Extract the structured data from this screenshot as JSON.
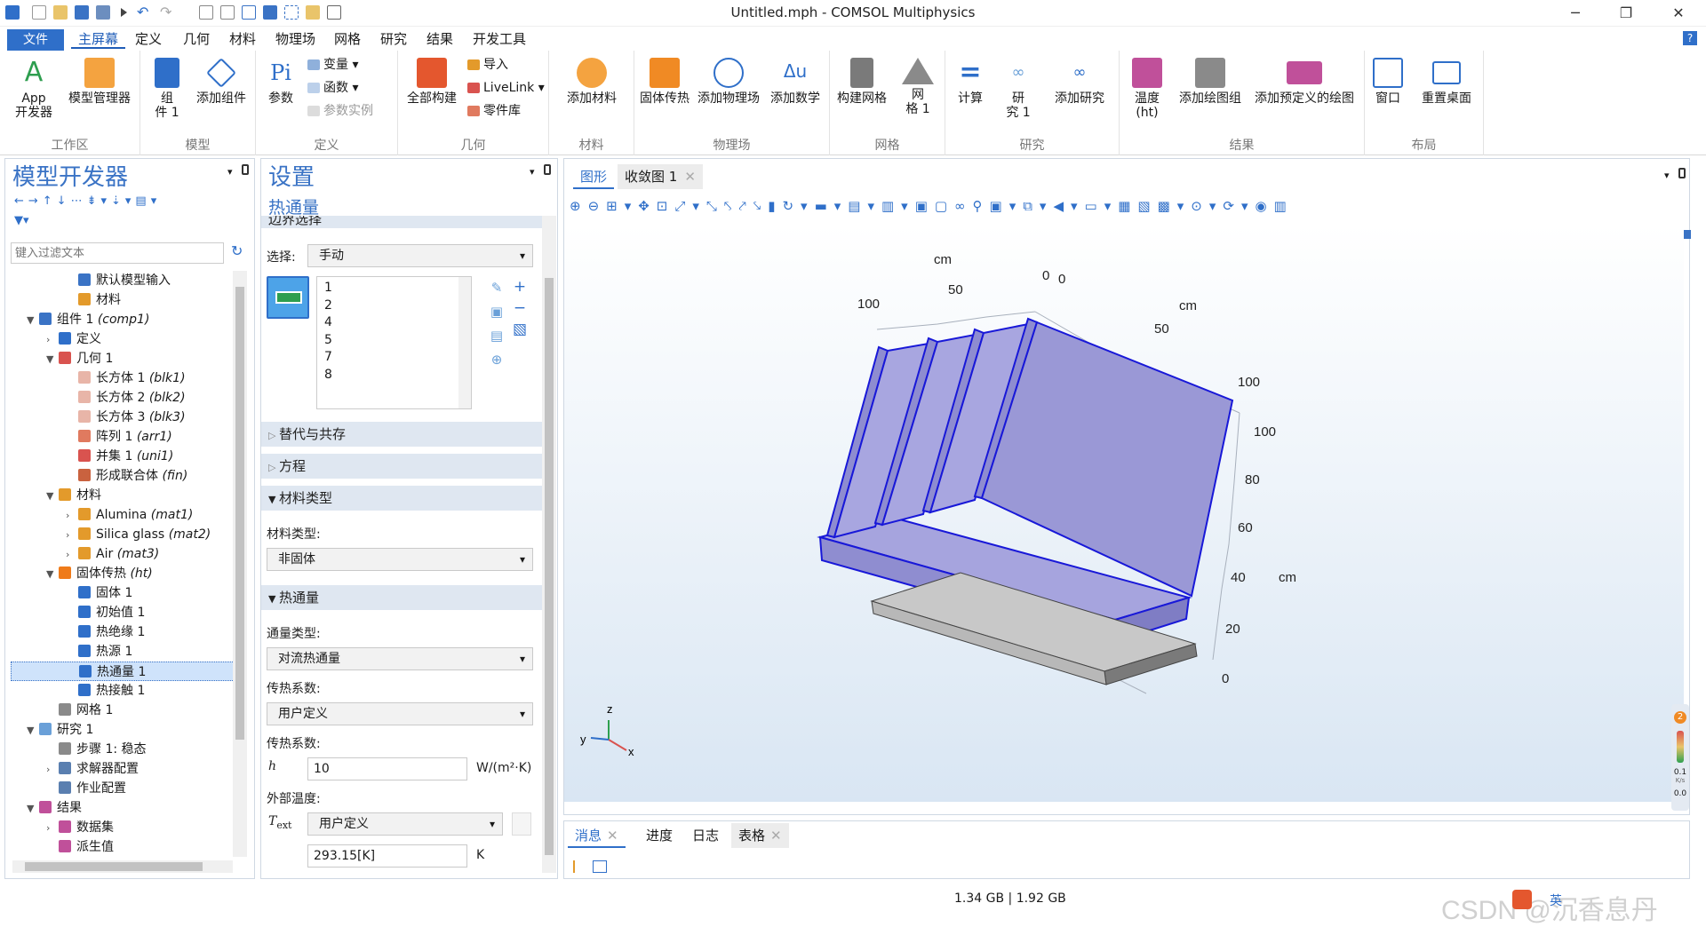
{
  "window": {
    "title": "Untitled.mph - COMSOL Multiphysics",
    "minimize": "─",
    "maximize": "❐",
    "close": "✕"
  },
  "menu": {
    "file": "文件",
    "items": [
      "主屏幕",
      "定义",
      "几何",
      "材料",
      "物理场",
      "网格",
      "研究",
      "结果",
      "开发工具"
    ],
    "help": "?"
  },
  "ribbon": {
    "groups": [
      {
        "label": "工作区",
        "buttons": [
          "App\n开发器",
          "模型管理器"
        ]
      },
      {
        "label": "模型",
        "buttons": [
          "组\n件 1",
          "添加组件"
        ]
      },
      {
        "label": "定义",
        "buttons": [
          "参数"
        ],
        "small": [
          "变量",
          "函数",
          "参数实例"
        ]
      },
      {
        "label": "几何",
        "buttons": [
          "全部构建"
        ],
        "small": [
          "导入",
          "LiveLink",
          "零件库"
        ]
      },
      {
        "label": "材料",
        "buttons": [
          "添加材料"
        ]
      },
      {
        "label": "物理场",
        "buttons": [
          "固体传热",
          "添加物理场",
          "添加数学"
        ]
      },
      {
        "label": "网格",
        "buttons": [
          "构建网格",
          "网\n格 1"
        ]
      },
      {
        "label": "研究",
        "buttons": [
          "计算",
          "研\n究 1",
          "添加研究"
        ]
      },
      {
        "label": "结果",
        "buttons": [
          "温度\n(ht)",
          "添加绘图组",
          "添加预定义的绘图"
        ]
      },
      {
        "label": "布局",
        "buttons": [
          "窗口",
          "重置桌面"
        ]
      }
    ]
  },
  "model_builder": {
    "title": "模型开发器",
    "filter_placeholder": "键入过滤文本",
    "tree": [
      {
        "label": "默认模型输入",
        "tag": "",
        "indent": 3,
        "caret": "",
        "color": "#3a73c5"
      },
      {
        "label": "材料",
        "tag": "",
        "indent": 3,
        "caret": "",
        "color": "#e39a2b"
      },
      {
        "label": "组件 1 ",
        "tag": "(comp1)",
        "indent": 1,
        "caret": "▼",
        "color": "#3a73c5"
      },
      {
        "label": "定义",
        "tag": "",
        "indent": 2,
        "caret": "›",
        "color": "#2f6fc9"
      },
      {
        "label": "几何 1",
        "tag": "",
        "indent": 2,
        "caret": "▼",
        "color": "#d9534f"
      },
      {
        "label": "长方体 1 ",
        "tag": "(blk1)",
        "indent": 3,
        "caret": "",
        "color": "#e8b5a8"
      },
      {
        "label": "长方体 2 ",
        "tag": "(blk2)",
        "indent": 3,
        "caret": "",
        "color": "#e8b5a8"
      },
      {
        "label": "长方体 3 ",
        "tag": "(blk3)",
        "indent": 3,
        "caret": "",
        "color": "#e8b5a8"
      },
      {
        "label": "阵列 1 ",
        "tag": "(arr1)",
        "indent": 3,
        "caret": "",
        "color": "#e07a5f"
      },
      {
        "label": "并集 1 ",
        "tag": "(uni1)",
        "indent": 3,
        "caret": "",
        "color": "#d9534f"
      },
      {
        "label": "形成联合体 ",
        "tag": "(fin)",
        "indent": 3,
        "caret": "",
        "color": "#c9623f"
      },
      {
        "label": "材料",
        "tag": "",
        "indent": 2,
        "caret": "▼",
        "color": "#e39a2b"
      },
      {
        "label": "Alumina ",
        "tag": "(mat1)",
        "indent": 3,
        "caret": "›",
        "color": "#e39a2b"
      },
      {
        "label": "Silica glass ",
        "tag": "(mat2)",
        "indent": 3,
        "caret": "›",
        "color": "#e39a2b"
      },
      {
        "label": "Air ",
        "tag": "(mat3)",
        "indent": 3,
        "caret": "›",
        "color": "#e39a2b"
      },
      {
        "label": "固体传热 ",
        "tag": "(ht)",
        "indent": 2,
        "caret": "▼",
        "color": "#ef7b1a"
      },
      {
        "label": "固体 1",
        "tag": "",
        "indent": 3,
        "caret": "",
        "color": "#2f6fc9"
      },
      {
        "label": "初始值 1",
        "tag": "",
        "indent": 3,
        "caret": "",
        "color": "#2f6fc9"
      },
      {
        "label": "热绝缘 1",
        "tag": "",
        "indent": 3,
        "caret": "",
        "color": "#2f6fc9"
      },
      {
        "label": "热源 1",
        "tag": "",
        "indent": 3,
        "caret": "",
        "color": "#2f6fc9"
      },
      {
        "label": "热通量 1",
        "tag": "",
        "indent": 3,
        "caret": "",
        "color": "#2f6fc9",
        "selected": true
      },
      {
        "label": "热接触 1",
        "tag": "",
        "indent": 3,
        "caret": "",
        "color": "#2f6fc9"
      },
      {
        "label": "网格 1",
        "tag": "",
        "indent": 2,
        "caret": "",
        "color": "#8a8a8a"
      },
      {
        "label": "研究 1",
        "tag": "",
        "indent": 1,
        "caret": "▼",
        "color": "#6aa0d8"
      },
      {
        "label": "步骤 1: 稳态",
        "tag": "",
        "indent": 2,
        "caret": "",
        "color": "#8a8a8a"
      },
      {
        "label": "求解器配置",
        "tag": "",
        "indent": 2,
        "caret": "›",
        "color": "#5a7fb0"
      },
      {
        "label": "作业配置",
        "tag": "",
        "indent": 2,
        "caret": "",
        "color": "#5a7fb0"
      },
      {
        "label": "结果",
        "tag": "",
        "indent": 1,
        "caret": "▼",
        "color": "#c0509a"
      },
      {
        "label": "数据集",
        "tag": "",
        "indent": 2,
        "caret": "›",
        "color": "#c0509a"
      },
      {
        "label": "派生值",
        "tag": "",
        "indent": 2,
        "caret": "",
        "color": "#c0509a"
      }
    ]
  },
  "settings": {
    "title": "设置",
    "subtitle": "热通量",
    "cut_section": "边界选择",
    "selection_label": "选择:",
    "selection_value": "手动",
    "boundaries": [
      "1",
      "2",
      "4",
      "5",
      "7",
      "8"
    ],
    "sections": {
      "override": "替代与共存",
      "equation": "方程",
      "material_type": "材料类型",
      "heat_flux": "热通量"
    },
    "material_type_label": "材料类型:",
    "material_type_value": "非固体",
    "flux_type_label": "通量类型:",
    "flux_type_value": "对流热通量",
    "htc_label": "传热系数:",
    "htc_value": "用户定义",
    "htc_label2": "传热系数:",
    "h_symbol": "h",
    "h_value": "10",
    "h_unit": "W/(m²·K)",
    "ext_temp_label": "外部温度:",
    "text_symbol": "T",
    "text_sub": "ext",
    "text_combo": "用户定义",
    "text_value": "293.15[K]",
    "text_unit": "K"
  },
  "graphics": {
    "tabs": [
      "图形",
      "收敛图 1"
    ],
    "axis_labels": {
      "cm_top": "cm",
      "cm_right": "cm",
      "cm_z": "cm"
    },
    "x_ticks": [
      "100",
      "50",
      "0"
    ],
    "x0": "0",
    "y_ticks": [
      "50",
      "100"
    ],
    "z_ticks": [
      "100",
      "80",
      "60",
      "40",
      "20",
      "0"
    ],
    "triad": {
      "x": "x",
      "y": "y",
      "z": "z"
    },
    "colors": {
      "fin": "#9a98d6",
      "fin_edge": "#1818d8",
      "base": "#b8b8b8",
      "bg_top": "#ffffff",
      "bg_bottom": "#d9e6f3"
    }
  },
  "messages": {
    "tabs": [
      "消息",
      "进度",
      "日志",
      "表格"
    ]
  },
  "status": {
    "memory": "1.34 GB | 1.92 GB",
    "watermark": "CSDN @沉香息丹",
    "ime": "英"
  },
  "side_widget": {
    "badge": "2",
    "v1": "0.1",
    "v1_unit": "K/s",
    "v2": "0.0"
  }
}
